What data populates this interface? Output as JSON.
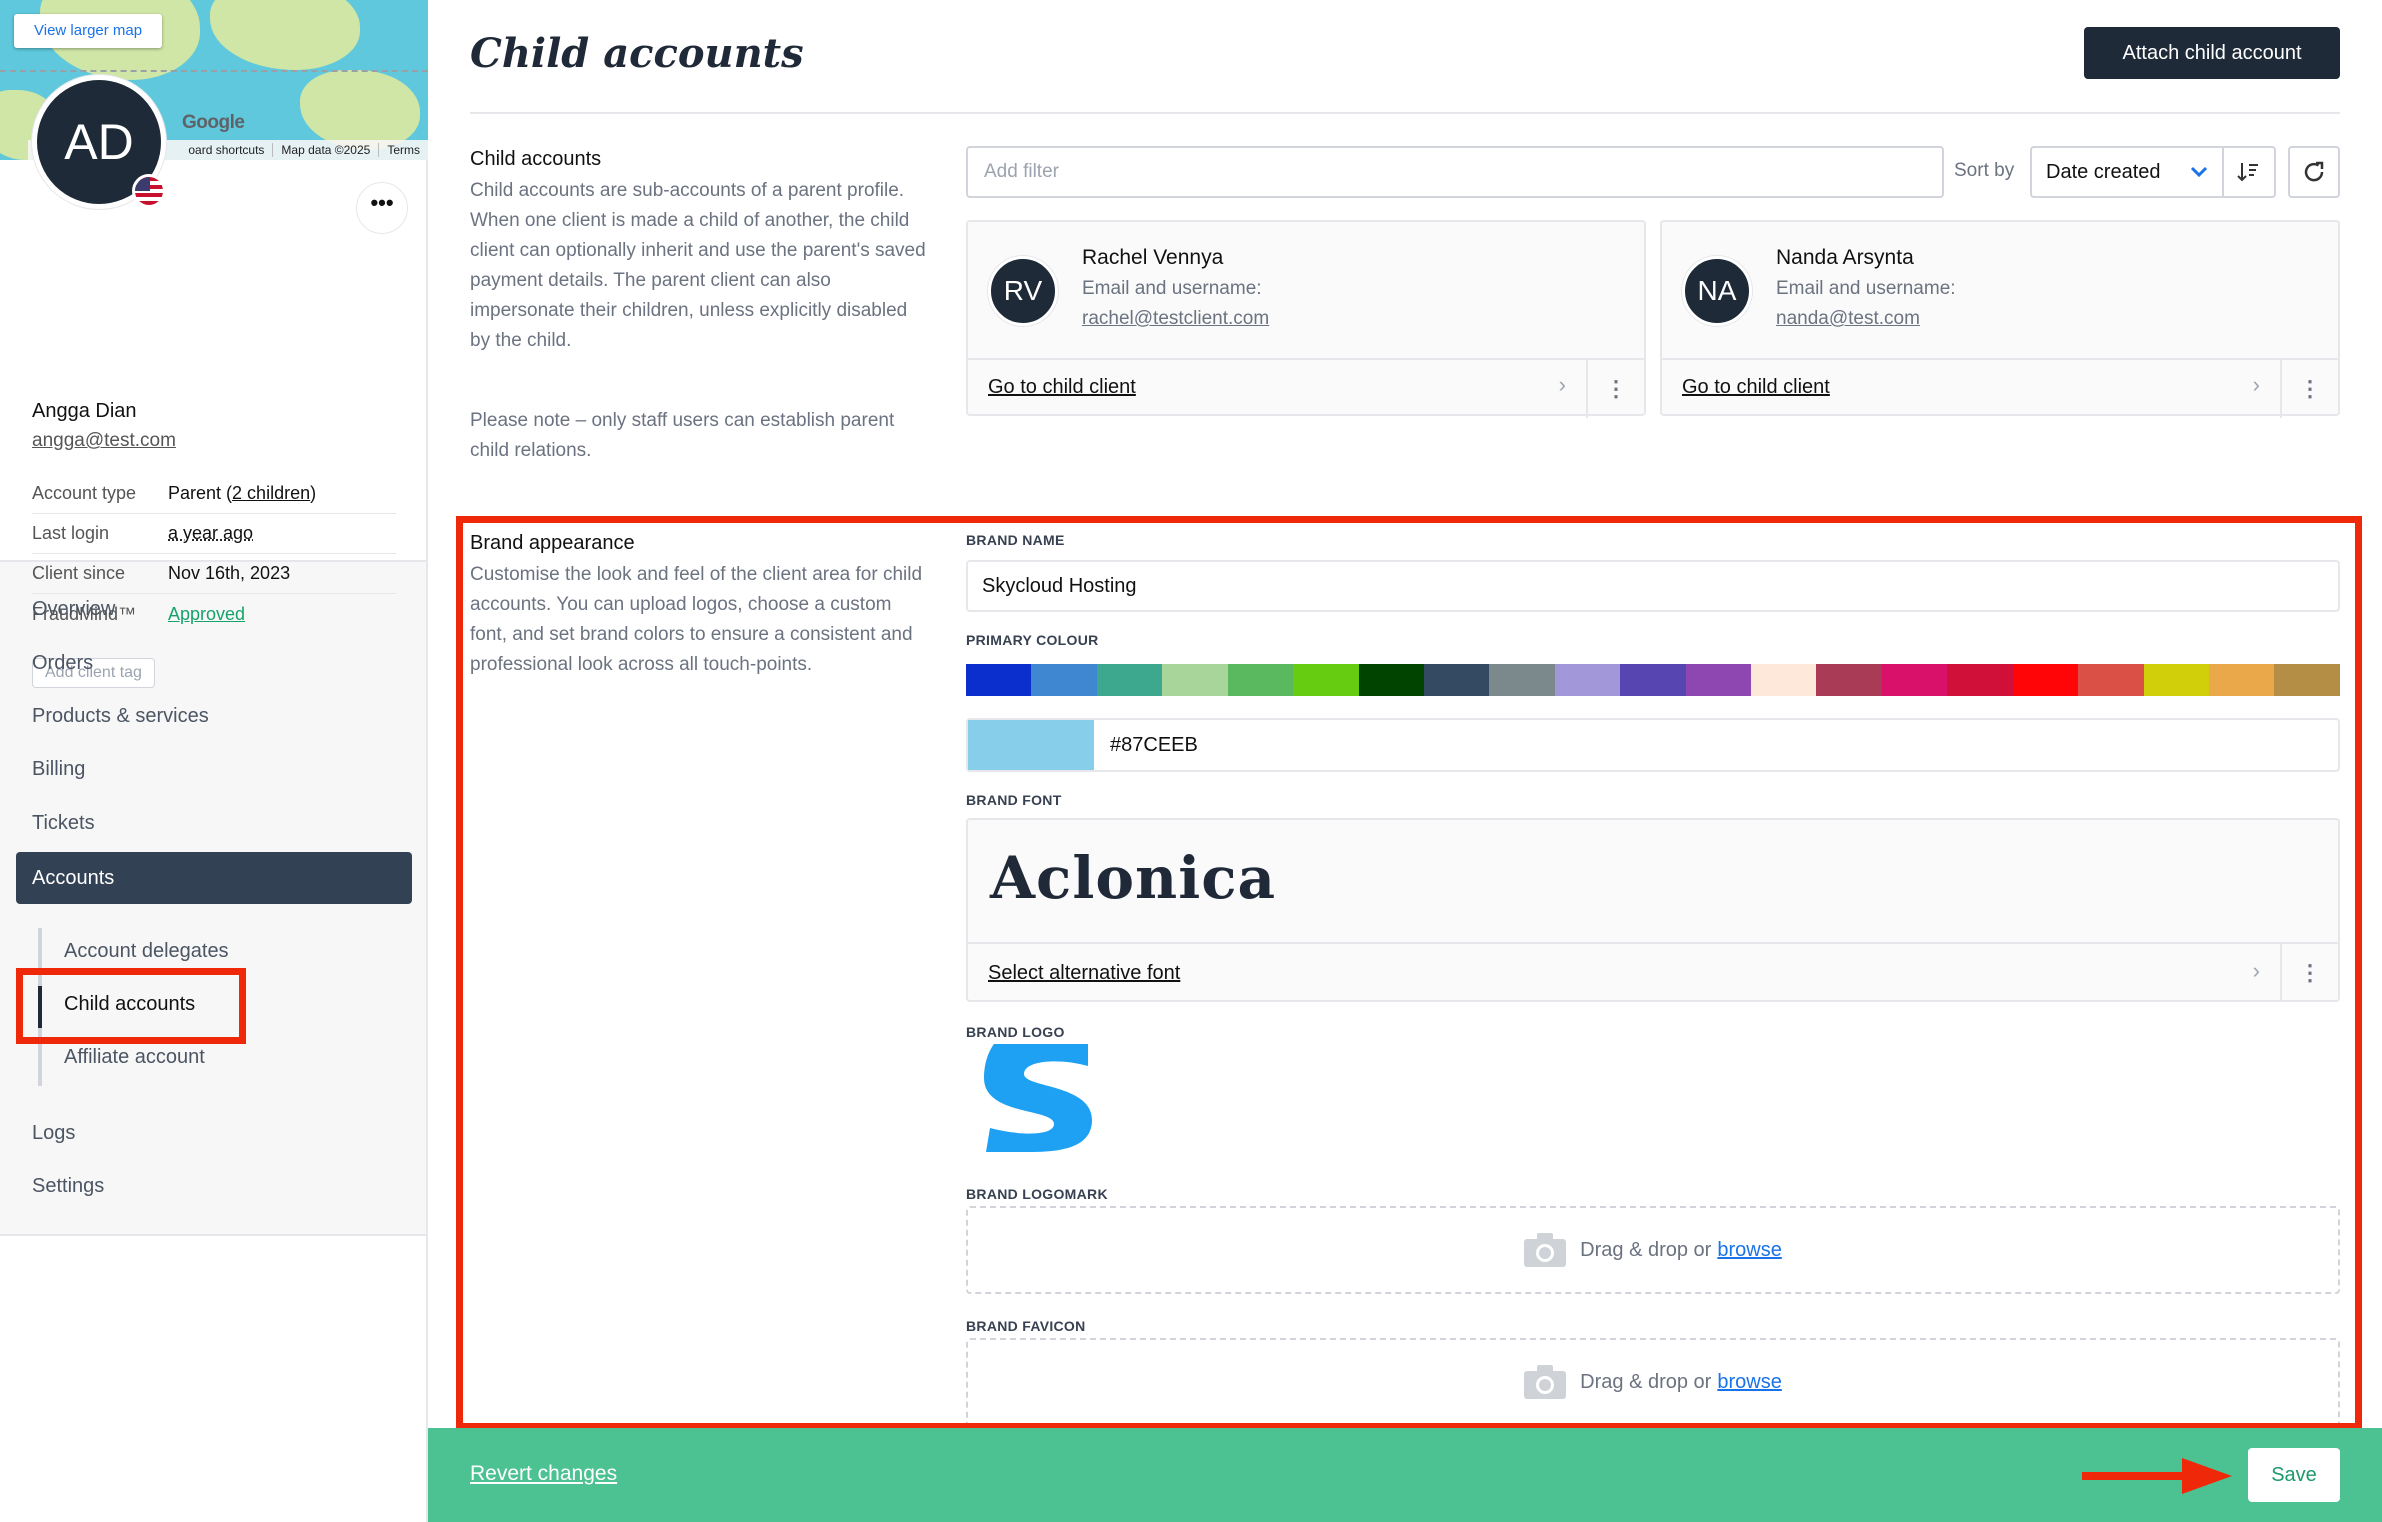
{
  "map": {
    "view_larger": "View larger map",
    "google": "Google",
    "attribution": [
      "oard shortcuts",
      "Map data ©2025",
      "Terms"
    ]
  },
  "client": {
    "initials": "AD",
    "name": "Angga Dian",
    "email": "angga@test.com",
    "more_glyph": "•••",
    "info": [
      {
        "key": "Account type",
        "value": "Parent",
        "extra": "2 children"
      },
      {
        "key": "Last login",
        "value": "a year ago"
      },
      {
        "key": "Client since",
        "value": "Nov 16th, 2023"
      },
      {
        "key": "FraudMind™",
        "value": "Approved"
      }
    ],
    "add_tag": "Add client tag"
  },
  "nav": {
    "items": [
      "Overview",
      "Orders",
      "Products & services",
      "Billing",
      "Tickets"
    ],
    "active": "Accounts",
    "sub_items": [
      "Account delegates",
      "Child accounts",
      "Affiliate account"
    ],
    "active_sub": "Child accounts",
    "bottom_items": [
      "Logs",
      "Settings"
    ]
  },
  "header": {
    "title": "Child accounts",
    "attach_button": "Attach child account"
  },
  "child_section": {
    "heading": "Child accounts",
    "description": "Child accounts are sub-accounts of a parent profile. When one client is made a child of another, the child client can optionally inherit and use the parent's saved payment details. The parent client can also impersonate their children, unless explicitly disabled by the child.",
    "note": "Please note – only staff users can establish parent child relations.",
    "filter_placeholder": "Add filter",
    "sort_label": "Sort by",
    "sort_value": "Date created",
    "children": [
      {
        "initials": "RV",
        "name": "Rachel Vennya",
        "label": "Email and username:",
        "email": "rachel@testclient.com",
        "link": "Go to child client"
      },
      {
        "initials": "NA",
        "name": "Nanda Arsynta",
        "label": "Email and username:",
        "email": "nanda@test.com",
        "link": "Go to child client"
      }
    ]
  },
  "brand_section": {
    "heading": "Brand appearance",
    "description": "Customise the look and feel of the client area for child accounts. You can upload logos, choose a custom font, and set brand colors to ensure a consistent and professional look across all touch-points.",
    "brand_name_label": "BRAND NAME",
    "brand_name_value": "Skycloud Hosting",
    "primary_colour_label": "PRIMARY COLOUR",
    "swatches": [
      "#0a2fcc",
      "#3f87d1",
      "#3ea88f",
      "#a7d59a",
      "#5ab95e",
      "#66cc11",
      "#004400",
      "#344962",
      "#7b898c",
      "#a197d9",
      "#5746b2",
      "#8e47b1",
      "#fde8d9",
      "#a93b56",
      "#d9116a",
      "#d1103a",
      "#ff0508",
      "#db5046",
      "#d0cf09",
      "#eba84a",
      "#b48e44"
    ],
    "colour_value": "#87CEEB",
    "brand_font_label": "BRAND FONT",
    "font_sample": "Aclonica",
    "font_link": "Select alternative font",
    "brand_logo_label": "BRAND LOGO",
    "logo_color": "#1ea1f2",
    "logomark_label": "BRAND LOGOMARK",
    "favicon_label": "BRAND FAVICON",
    "dropzone_text": "Drag & drop or",
    "browse_text": "browse"
  },
  "save_bar": {
    "revert": "Revert changes",
    "save": "Save",
    "color": "#4cc293"
  },
  "highlight_color": "#f0280a"
}
